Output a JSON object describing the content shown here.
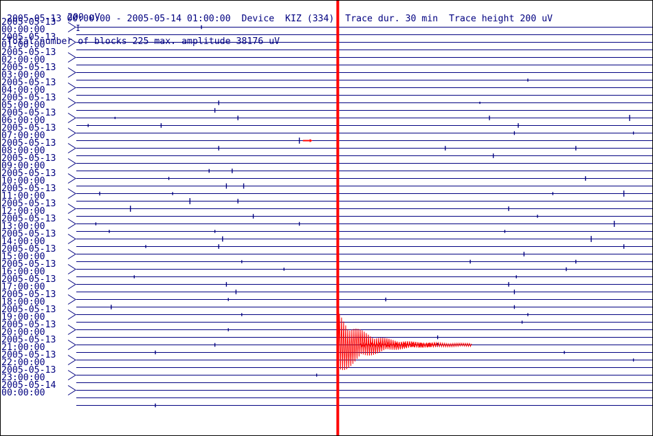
{
  "header": {
    "line1": "2005-05-13 00:00:00 - 2005-05-14 01:00:00  Device  KIZ (334)  Trace dur. 30 min  Trace height 200 uV",
    "line2": "Total number of blocks 225 max. amplitude 38176 uV"
  },
  "scale": {
    "label": "200 uV"
  },
  "time_labels": [
    {
      "date": "2005-05-13",
      "time": "00:00:00"
    },
    {
      "date": "2005-05-13",
      "time": "01:00:00"
    },
    {
      "date": "2005-05-13",
      "time": "02:00:00"
    },
    {
      "date": "2005-05-13",
      "time": "03:00:00"
    },
    {
      "date": "2005-05-13",
      "time": "04:00:00"
    },
    {
      "date": "2005-05-13",
      "time": "05:00:00"
    },
    {
      "date": "2005-05-13",
      "time": "06:00:00"
    },
    {
      "date": "2005-05-13",
      "time": "07:00:00"
    },
    {
      "date": "2005-05-13",
      "time": "08:00:00"
    },
    {
      "date": "2005-05-13",
      "time": "09:00:00"
    },
    {
      "date": "2005-05-13",
      "time": "10:00:00"
    },
    {
      "date": "2005-05-13",
      "time": "11:00:00"
    },
    {
      "date": "2005-05-13",
      "time": "12:00:00"
    },
    {
      "date": "2005-05-13",
      "time": "13:00:00"
    },
    {
      "date": "2005-05-13",
      "time": "14:00:00"
    },
    {
      "date": "2005-05-13",
      "time": "15:00:00"
    },
    {
      "date": "2005-05-13",
      "time": "16:00:00"
    },
    {
      "date": "2005-05-13",
      "time": "17:00:00"
    },
    {
      "date": "2005-05-13",
      "time": "18:00:00"
    },
    {
      "date": "2005-05-13",
      "time": "19:00:00"
    },
    {
      "date": "2005-05-13",
      "time": "20:00:00"
    },
    {
      "date": "2005-05-13",
      "time": "21:00:00"
    },
    {
      "date": "2005-05-13",
      "time": "22:00:00"
    },
    {
      "date": "2005-05-13",
      "time": "23:00:00"
    },
    {
      "date": "2005-05-14",
      "time": "00:00:00"
    }
  ],
  "colors": {
    "trace": "#000080",
    "event": "#ff0000",
    "text": "#000080",
    "background": "#ffffff"
  },
  "chart_data": {
    "type": "line",
    "title": "",
    "xlabel": "",
    "ylabel": "",
    "trace_duration_min": 30,
    "trace_height_uV": 200,
    "total_blocks": 225,
    "max_amplitude_uV": 38176,
    "start": "2005-05-13 00:00:00",
    "end": "2005-05-14 01:00:00",
    "series": [
      {
        "trace_count": 50,
        "spikes": [
          {
            "trace": 0,
            "minute": 6.5,
            "amp": 0.25
          },
          {
            "trace": 7,
            "minute": 23.5,
            "amp": 0.2
          },
          {
            "trace": 10,
            "minute": 7.4,
            "amp": 0.3
          },
          {
            "trace": 10,
            "minute": 21.0,
            "amp": 0.15
          },
          {
            "trace": 11,
            "minute": 7.2,
            "amp": 0.3
          },
          {
            "trace": 12,
            "minute": 2.0,
            "amp": 0.15
          },
          {
            "trace": 12,
            "minute": 8.4,
            "amp": 0.3
          },
          {
            "trace": 12,
            "minute": 21.5,
            "amp": 0.3
          },
          {
            "trace": 12,
            "minute": 28.8,
            "amp": 0.4
          },
          {
            "trace": 13,
            "minute": 0.6,
            "amp": 0.2
          },
          {
            "trace": 13,
            "minute": 4.4,
            "amp": 0.3
          },
          {
            "trace": 13,
            "minute": 23.0,
            "amp": 0.3
          },
          {
            "trace": 14,
            "minute": 22.8,
            "amp": 0.25
          },
          {
            "trace": 14,
            "minute": 29.0,
            "amp": 0.2
          },
          {
            "trace": 15,
            "minute": 11.6,
            "amp": 0.4
          },
          {
            "trace": 16,
            "minute": 7.4,
            "amp": 0.3
          },
          {
            "trace": 16,
            "minute": 19.2,
            "amp": 0.3
          },
          {
            "trace": 16,
            "minute": 26.0,
            "amp": 0.3
          },
          {
            "trace": 17,
            "minute": 21.7,
            "amp": 0.3
          },
          {
            "trace": 19,
            "minute": 6.9,
            "amp": 0.25
          },
          {
            "trace": 19,
            "minute": 8.1,
            "amp": 0.3
          },
          {
            "trace": 20,
            "minute": 4.8,
            "amp": 0.2
          },
          {
            "trace": 20,
            "minute": 26.5,
            "amp": 0.3
          },
          {
            "trace": 21,
            "minute": 7.8,
            "amp": 0.35
          },
          {
            "trace": 21,
            "minute": 8.7,
            "amp": 0.35
          },
          {
            "trace": 22,
            "minute": 1.2,
            "amp": 0.25
          },
          {
            "trace": 22,
            "minute": 5.0,
            "amp": 0.2
          },
          {
            "trace": 22,
            "minute": 24.8,
            "amp": 0.2
          },
          {
            "trace": 22,
            "minute": 28.5,
            "amp": 0.4
          },
          {
            "trace": 23,
            "minute": 5.9,
            "amp": 0.4
          },
          {
            "trace": 23,
            "minute": 8.4,
            "amp": 0.3
          },
          {
            "trace": 24,
            "minute": 2.8,
            "amp": 0.4
          },
          {
            "trace": 24,
            "minute": 22.5,
            "amp": 0.3
          },
          {
            "trace": 25,
            "minute": 9.2,
            "amp": 0.3
          },
          {
            "trace": 25,
            "minute": 24.0,
            "amp": 0.2
          },
          {
            "trace": 26,
            "minute": 1.0,
            "amp": 0.2
          },
          {
            "trace": 26,
            "minute": 11.6,
            "amp": 0.25
          },
          {
            "trace": 26,
            "minute": 28.0,
            "amp": 0.4
          },
          {
            "trace": 27,
            "minute": 1.7,
            "amp": 0.2
          },
          {
            "trace": 27,
            "minute": 7.2,
            "amp": 0.2
          },
          {
            "trace": 27,
            "minute": 22.3,
            "amp": 0.2
          },
          {
            "trace": 28,
            "minute": 7.6,
            "amp": 0.35
          },
          {
            "trace": 28,
            "minute": 26.8,
            "amp": 0.4
          },
          {
            "trace": 29,
            "minute": 3.6,
            "amp": 0.2
          },
          {
            "trace": 29,
            "minute": 7.4,
            "amp": 0.3
          },
          {
            "trace": 29,
            "minute": 28.5,
            "amp": 0.3
          },
          {
            "trace": 30,
            "minute": 23.3,
            "amp": 0.3
          },
          {
            "trace": 31,
            "minute": 8.6,
            "amp": 0.2
          },
          {
            "trace": 31,
            "minute": 20.5,
            "amp": 0.25
          },
          {
            "trace": 31,
            "minute": 26.0,
            "amp": 0.25
          },
          {
            "trace": 31,
            "minute": 30.0,
            "amp": 0.25
          },
          {
            "trace": 32,
            "minute": 10.8,
            "amp": 0.2
          },
          {
            "trace": 32,
            "minute": 25.5,
            "amp": 0.25
          },
          {
            "trace": 33,
            "minute": 3.0,
            "amp": 0.2
          },
          {
            "trace": 33,
            "minute": 22.9,
            "amp": 0.2
          },
          {
            "trace": 34,
            "minute": 7.8,
            "amp": 0.3
          },
          {
            "trace": 34,
            "minute": 22.5,
            "amp": 0.3
          },
          {
            "trace": 35,
            "minute": 8.3,
            "amp": 0.3
          },
          {
            "trace": 35,
            "minute": 22.8,
            "amp": 0.3
          },
          {
            "trace": 36,
            "minute": 7.9,
            "amp": 0.2
          },
          {
            "trace": 36,
            "minute": 16.1,
            "amp": 0.25
          },
          {
            "trace": 37,
            "minute": 1.8,
            "amp": 0.3
          },
          {
            "trace": 37,
            "minute": 22.8,
            "amp": 0.25
          },
          {
            "trace": 38,
            "minute": 8.6,
            "amp": 0.2
          },
          {
            "trace": 38,
            "minute": 23.5,
            "amp": 0.2
          },
          {
            "trace": 39,
            "minute": 23.2,
            "amp": 0.2
          },
          {
            "trace": 40,
            "minute": 7.9,
            "amp": 0.2
          },
          {
            "trace": 41,
            "minute": 18.8,
            "amp": 0.25
          },
          {
            "trace": 42,
            "minute": 7.2,
            "amp": 0.25
          },
          {
            "trace": 42,
            "minute": 18.8,
            "amp": 0.25
          },
          {
            "trace": 43,
            "minute": 4.1,
            "amp": 0.25
          },
          {
            "trace": 43,
            "minute": 25.4,
            "amp": 0.2
          },
          {
            "trace": 44,
            "minute": 29.0,
            "amp": 0.2
          },
          {
            "trace": 46,
            "minute": 12.5,
            "amp": 0.2
          },
          {
            "trace": 50,
            "minute": 4.1,
            "amp": 0.25
          }
        ]
      },
      {
        "name": "",
        "events": [
          {
            "trace": 42,
            "onset_minute": 13.6,
            "duration_min": 7.0,
            "peak_amp": 38176
          },
          {
            "trace": 42,
            "onset_minute": 14.8,
            "duration_min": 4.0,
            "peak_amp": 2.5
          },
          {
            "trace": 15,
            "onset_minute": 11.8,
            "duration_min": 0.4,
            "peak_amp": 0.2
          }
        ]
      }
    ]
  }
}
